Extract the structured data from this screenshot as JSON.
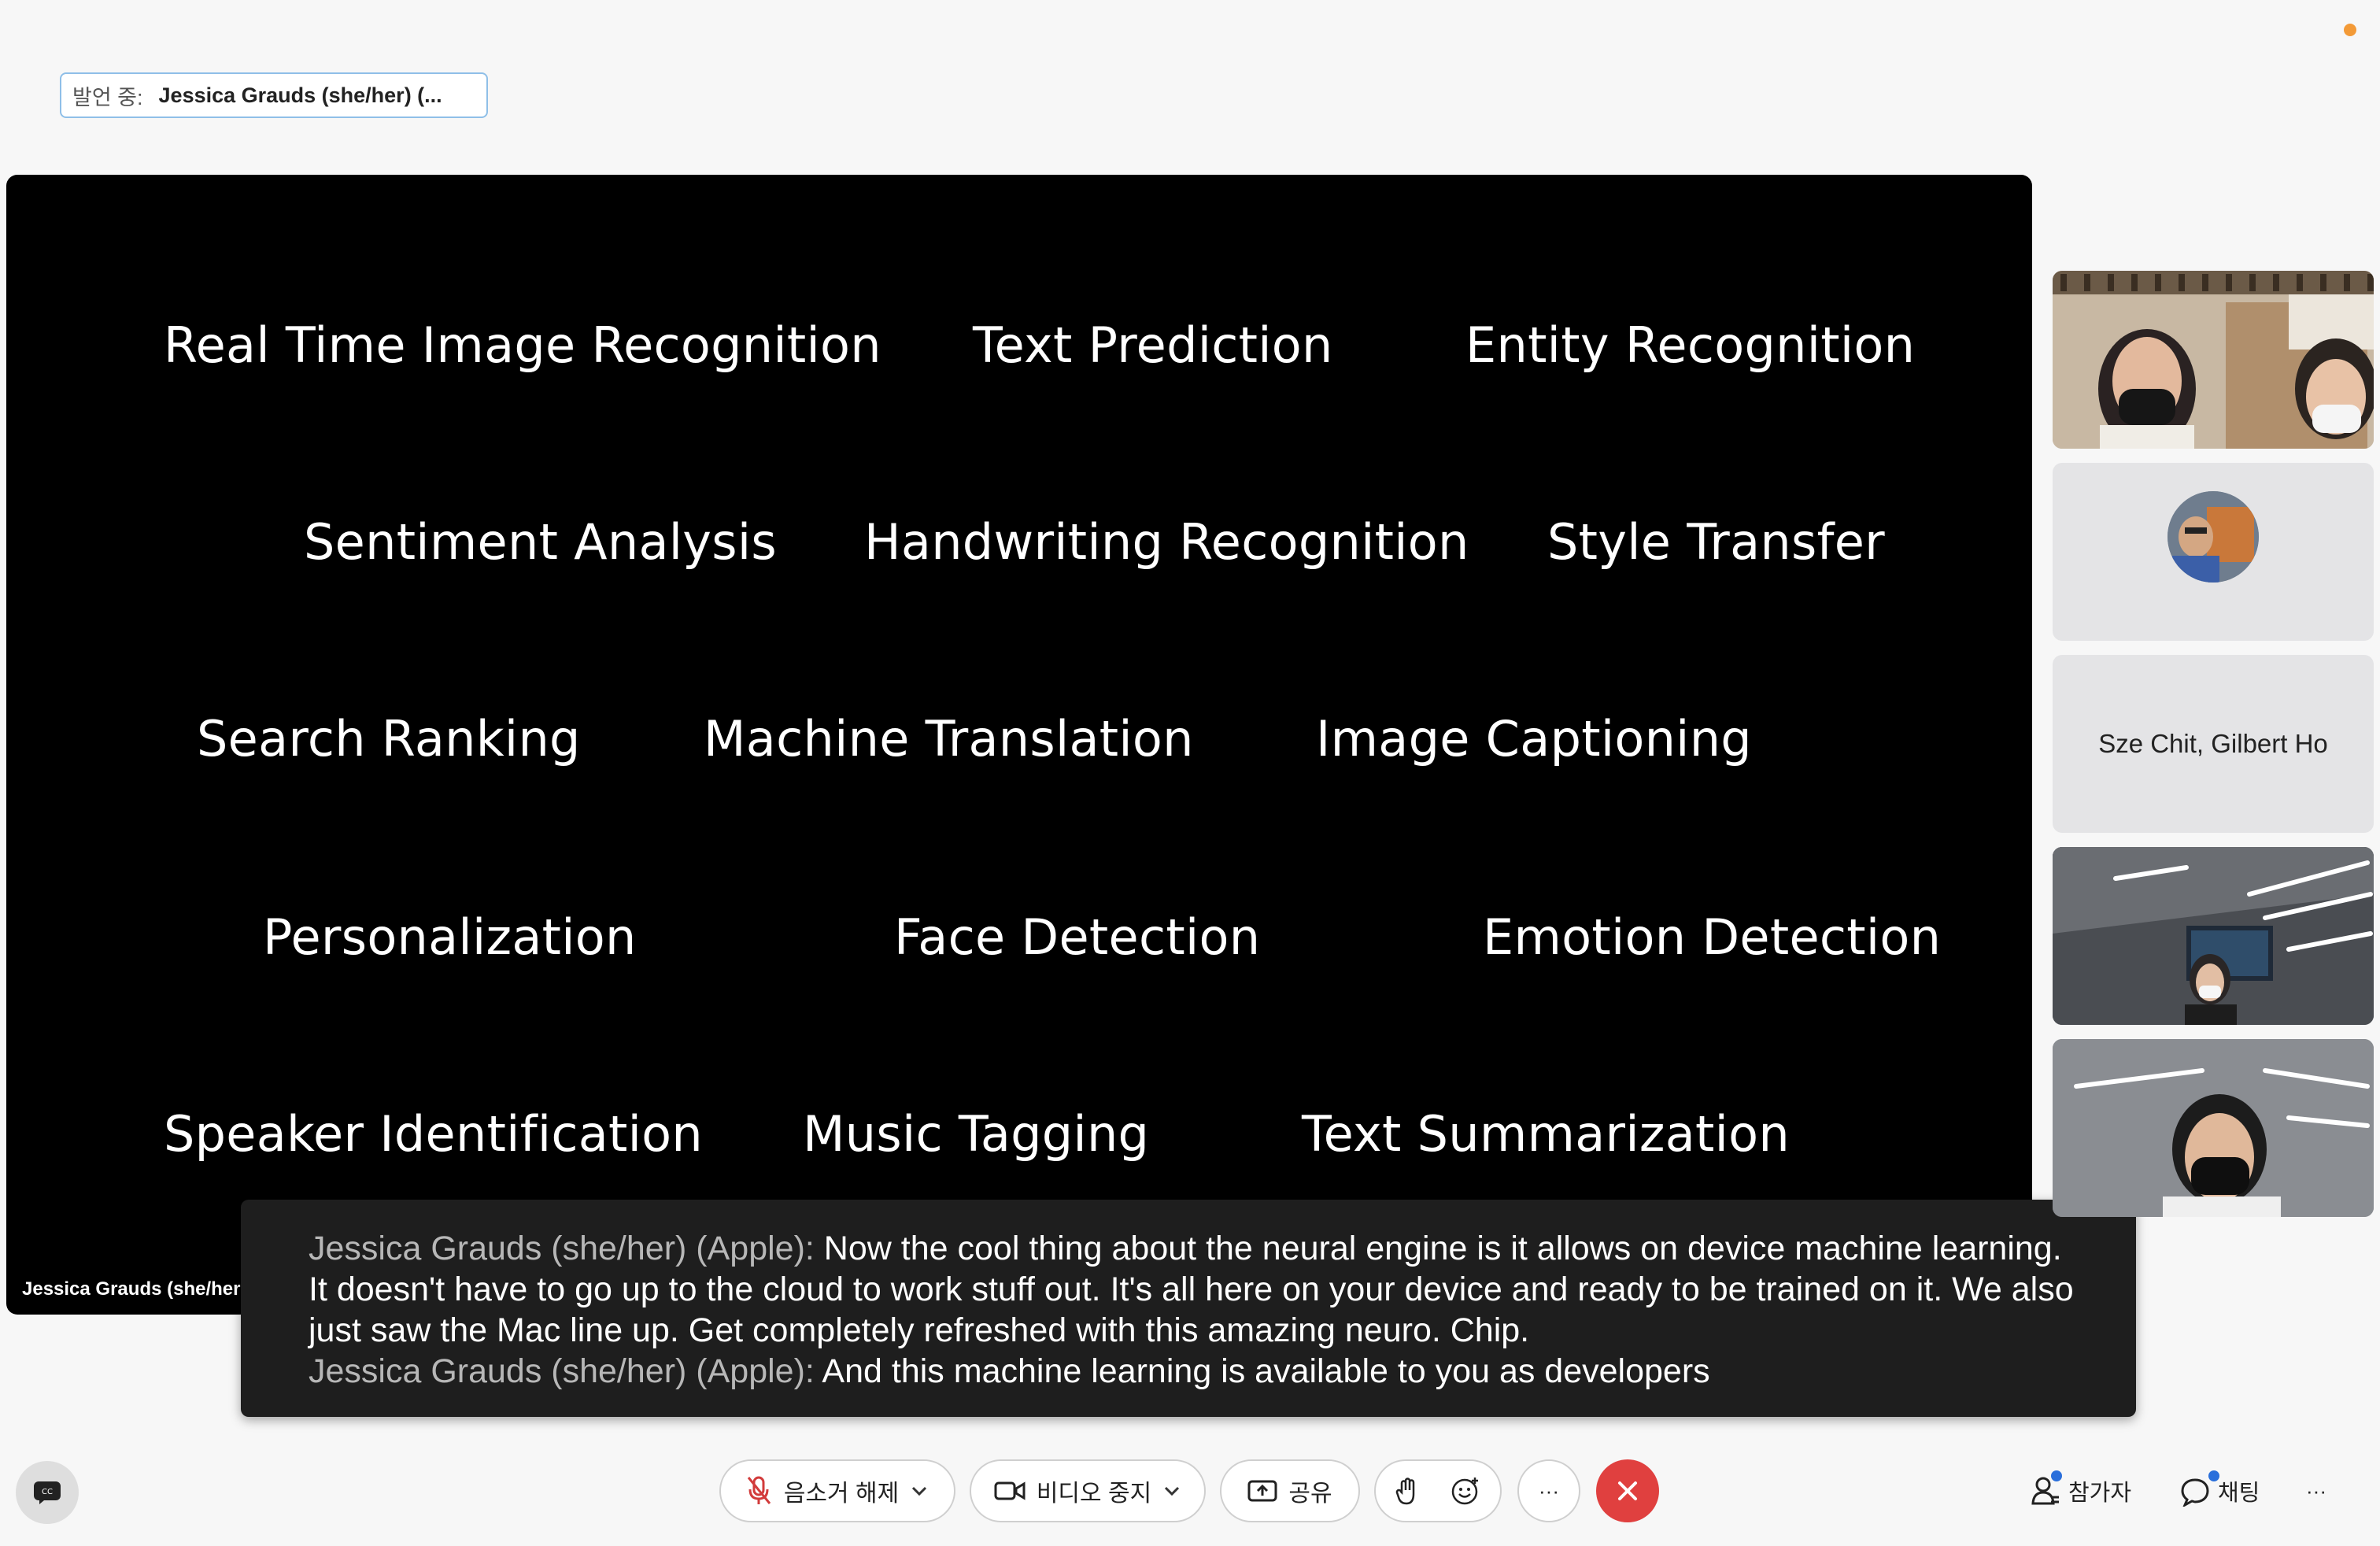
{
  "status": {
    "speaking_label": "발언 중:",
    "speaking_name": "Jessica Grauds (she/her) (..."
  },
  "share": {
    "presenter_label": "Jessica Grauds (she/her",
    "words": [
      "Real Time Image Recognition",
      "Text Prediction",
      "Entity Recognition",
      "Sentiment Analysis",
      "Handwriting Recognition",
      "Style Transfer",
      "Search Ranking",
      "Machine Translation",
      "Image Captioning",
      "Personalization",
      "Face Detection",
      "Emotion Detection",
      "Speaker Identification",
      "Music Tagging",
      "Text Summarization"
    ]
  },
  "captions": [
    {
      "speaker": "Jessica Grauds (she/her) (Apple):",
      "text": " Now the cool thing about the neural engine is it allows on device machine learning."
    },
    {
      "speaker": "",
      "text": "It doesn't have to go up to the cloud to work stuff out. It's all here on your device and ready to be trained on it. We also"
    },
    {
      "speaker": "",
      "text": "just saw the Mac line up. Get completely refreshed with this amazing neuro. Chip."
    },
    {
      "speaker": "Jessica Grauds (she/her) (Apple):",
      "text": " And this machine learning is available to you as developers"
    }
  ],
  "participants": {
    "name_only_tile": "Sze Chit, Gilbert Ho"
  },
  "toolbar": {
    "unmute_label": "음소거 해제",
    "stop_video_label": "비디오 중지",
    "share_label": "공유",
    "more_label": "···",
    "participants_label": "참가자",
    "chat_label": "채팅",
    "overflow_label": "···"
  },
  "icons": {
    "captions": "cc-icon",
    "mic": "mic-muted-icon",
    "video": "video-icon",
    "share": "share-screen-icon",
    "hand": "raise-hand-icon",
    "reaction": "emoji-reaction-icon",
    "leave": "close-icon",
    "participants": "person-icon",
    "chat": "chat-bubble-icon"
  },
  "colors": {
    "leave_red": "#e0403f",
    "notification_orange": "#f39a37",
    "badge_blue": "#2a6fdb",
    "caption_speaker_gray": "#b7b7b7"
  }
}
